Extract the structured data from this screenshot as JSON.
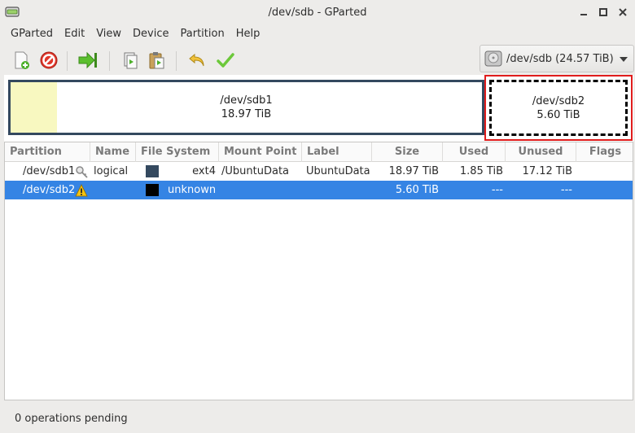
{
  "window": {
    "title": "/dev/sdb - GParted"
  },
  "menu": [
    "GParted",
    "Edit",
    "View",
    "Device",
    "Partition",
    "Help"
  ],
  "device": {
    "label": "/dev/sdb (24.57 TiB)"
  },
  "map": {
    "sdb1": {
      "name": "/dev/sdb1",
      "size": "18.97 TiB"
    },
    "sdb2": {
      "name": "/dev/sdb2",
      "size": "5.60 TiB"
    }
  },
  "table": {
    "headers": [
      "Partition",
      "Name",
      "File System",
      "Mount Point",
      "Label",
      "Size",
      "Used",
      "Unused",
      "Flags"
    ],
    "rows": [
      {
        "partition": "/dev/sdb1",
        "name": "logical",
        "fs": "ext4",
        "fs_color": "#34495f",
        "mount": "/UbuntuData",
        "label": "UbuntuData",
        "size": "18.97 TiB",
        "used": "1.85 TiB",
        "unused": "17.12 TiB",
        "flags": ""
      },
      {
        "partition": "/dev/sdb2",
        "name": "",
        "fs": "unknown",
        "fs_color": "#000000",
        "mount": "",
        "label": "",
        "size": "5.60 TiB",
        "used": "---",
        "unused": "---",
        "flags": ""
      }
    ]
  },
  "status": {
    "text": "0 operations pending"
  }
}
